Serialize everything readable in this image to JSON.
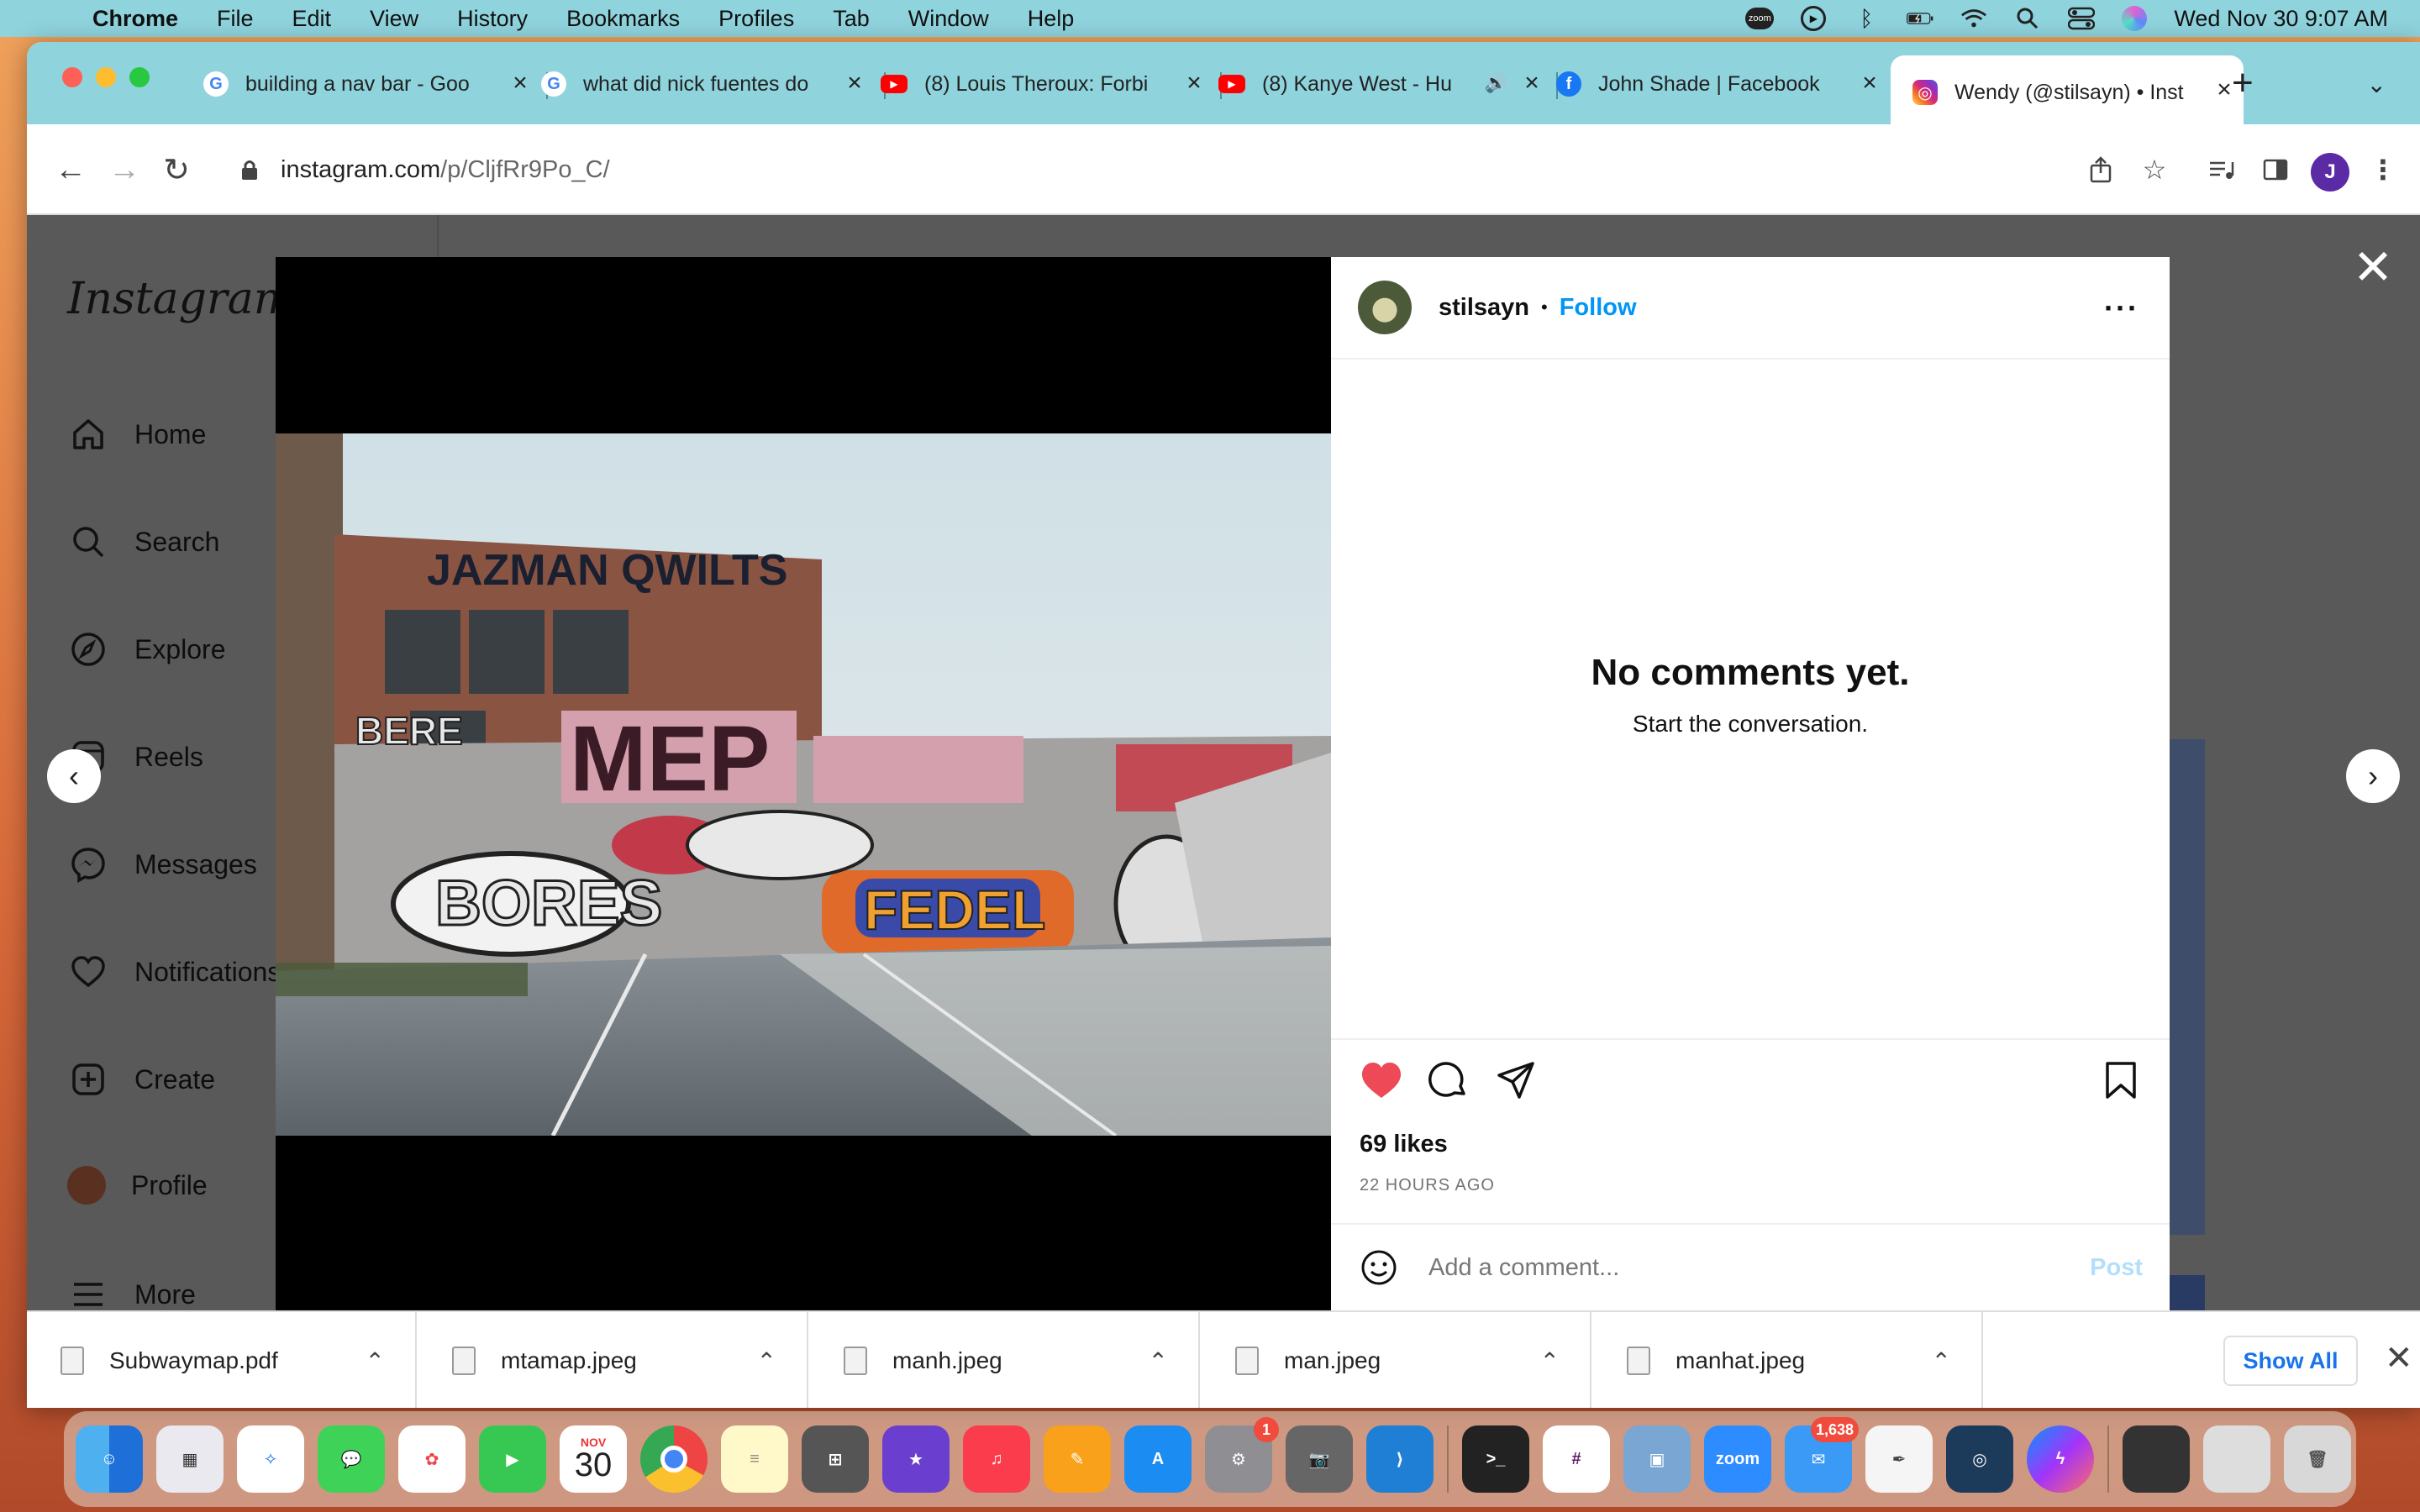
{
  "menubar": {
    "app_name": "Chrome",
    "menus": [
      "File",
      "Edit",
      "View",
      "History",
      "Bookmarks",
      "Profiles",
      "Tab",
      "Window",
      "Help"
    ],
    "clock": "Wed Nov 30  9:07 AM",
    "zoom_label": "zoom"
  },
  "tabs": [
    {
      "title": "building a nav bar - Goo",
      "icon": "google-icon"
    },
    {
      "title": "what did nick fuentes do",
      "icon": "google-icon"
    },
    {
      "title": "(8) Louis Theroux: Forbi",
      "icon": "youtube-icon"
    },
    {
      "title": "(8) Kanye West - Hu",
      "icon": "youtube-icon"
    },
    {
      "title": "John Shade | Facebook",
      "icon": "facebook-icon"
    },
    {
      "title": "Wendy (@stilsayn) • Inst",
      "icon": "instagram-icon",
      "active": true
    }
  ],
  "address": {
    "domain": "instagram.com",
    "path": "/p/CljfRr9Po_C/"
  },
  "profile_initial": "J",
  "instagram": {
    "logo": "Instagram",
    "nav": [
      "Home",
      "Search",
      "Explore",
      "Reels",
      "Messages",
      "Notifications",
      "Create",
      "Profile",
      "More"
    ]
  },
  "post": {
    "username": "stilsayn",
    "follow_label": "Follow",
    "no_comments_title": "No comments yet.",
    "no_comments_sub": "Start the conversation.",
    "likes": "69 likes",
    "time_ago": "22 HOURS AGO",
    "comment_placeholder": "Add a comment...",
    "post_label": "Post",
    "photo_signs": {
      "building_sign": "JAZMAN QWILTS",
      "big_letters": "MEP",
      "graffiti": [
        "BERE",
        "BORES",
        "FEDEL"
      ]
    }
  },
  "downloads": {
    "items": [
      "Subwaymap.pdf",
      "mtamap.jpeg",
      "manh.jpeg",
      "man.jpeg",
      "manhat.jpeg"
    ],
    "show_all": "Show All"
  },
  "dock": {
    "calendar_month": "NOV",
    "calendar_day": "30",
    "settings_badge": "1",
    "mail_badge": "1,638",
    "zoom_label": "zoom"
  },
  "colors": {
    "chrome_frame": "#8fd3dd",
    "instagram_blue": "#0095f6",
    "like_red": "#ed4956"
  }
}
